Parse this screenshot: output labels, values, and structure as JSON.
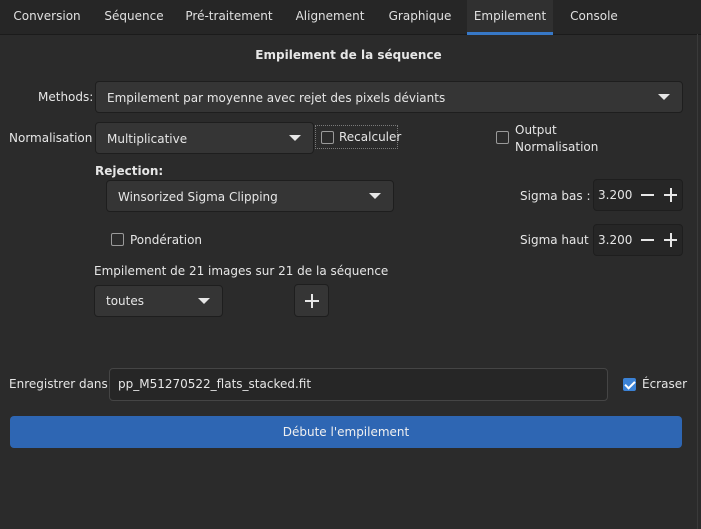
{
  "tabs": [
    {
      "label": "Conversion"
    },
    {
      "label": "Séquence"
    },
    {
      "label": "Pré-traitement"
    },
    {
      "label": "Alignement"
    },
    {
      "label": "Graphique"
    },
    {
      "label": "Empilement",
      "active": true
    },
    {
      "label": "Console"
    }
  ],
  "section_title": "Empilement de la séquence",
  "methods": {
    "label": "Methods:",
    "value": "Empilement par moyenne avec rejet des pixels déviants"
  },
  "normalisation": {
    "label": "Normalisation :",
    "value": "Multiplicative"
  },
  "recalculer": {
    "label": "Recalculer",
    "checked": false
  },
  "output_normalisation": {
    "label_line1": "Output",
    "label_line2": "Normalisation",
    "checked": false
  },
  "rejection": {
    "label": "Rejection:",
    "value": "Winsorized Sigma Clipping"
  },
  "sigma_bas": {
    "label": "Sigma bas :",
    "value": "3.200"
  },
  "sigma_haut": {
    "label": "Sigma haut :",
    "value": "3.200"
  },
  "ponderation": {
    "label": "Pondération",
    "checked": false
  },
  "images_info": "Empilement de 21 images sur 21 de la séquence",
  "filter": {
    "value": "toutes"
  },
  "save": {
    "label": "Enregistrer dans :",
    "value": "pp_M51270522_flats_stacked.fit"
  },
  "ecraser": {
    "label": "Écraser",
    "checked": true
  },
  "start_button": "Débute l'empilement",
  "colors": {
    "accent": "#3778c7",
    "button": "#2e66b3",
    "background": "#2b2b2b"
  }
}
